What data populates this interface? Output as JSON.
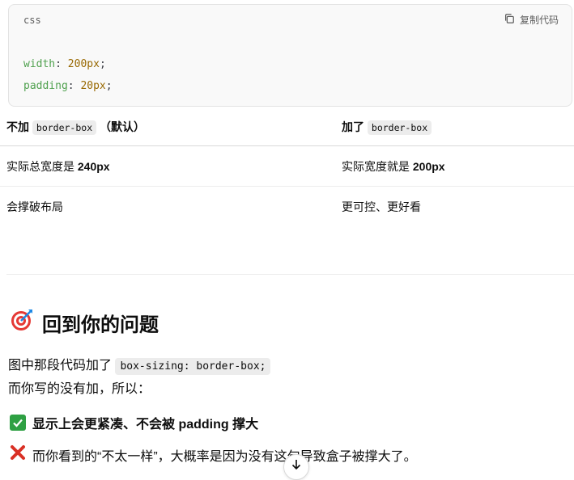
{
  "code_block": {
    "language": "css",
    "copy_label": "复制代码",
    "lines": [
      {
        "prop": "width",
        "colon": ": ",
        "value": "200px",
        "semi": ";"
      },
      {
        "prop": "padding",
        "colon": ": ",
        "value": "20px",
        "semi": ";"
      }
    ]
  },
  "table": {
    "headers": [
      {
        "pre": "不加 ",
        "code": "border-box",
        "post": " （默认）"
      },
      {
        "pre": "加了 ",
        "code": "border-box",
        "post": ""
      }
    ],
    "rows": [
      [
        {
          "text": "实际总宽度是 ",
          "bold": "240px"
        },
        {
          "text": "实际宽度就是 ",
          "bold": "200px"
        }
      ],
      [
        {
          "text": "会撑破布局",
          "bold": ""
        },
        {
          "text": "更可控、更好看",
          "bold": ""
        }
      ]
    ]
  },
  "section": {
    "heading": "回到你的问题",
    "heading_icon": "target-icon",
    "p1_text": "图中那段代码加了 ",
    "p1_code": "box-sizing: border-box;",
    "p2_text": "而你写的没有加，所以：",
    "bullet1": "显示上会更紧凑、不会被 padding 撑大",
    "bullet1_icon": "check-mark-icon",
    "bullet2": "而你看到的“不太一样”，大概率是因为没有这句导致盒子被撑大了。",
    "bullet2_icon": "cross-mark-icon"
  },
  "colors": {
    "check": "#2ea043",
    "cross": "#d93025",
    "css_property": "#50a14f",
    "css_number": "#986801"
  },
  "scroll_button_icon": "arrow-down-icon"
}
